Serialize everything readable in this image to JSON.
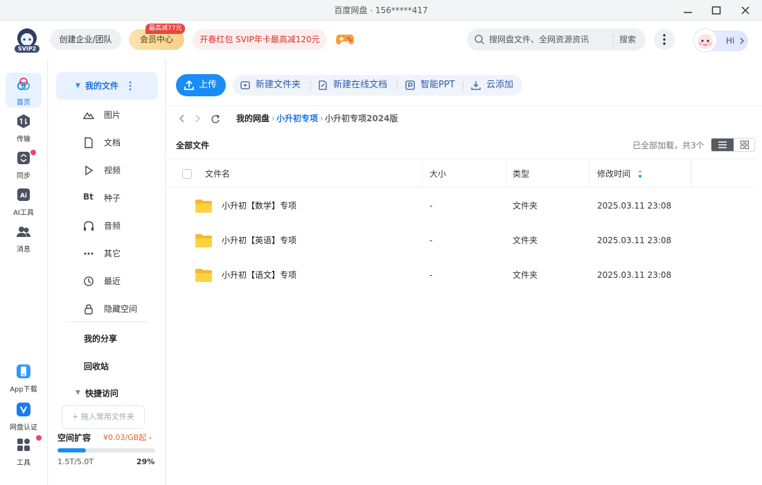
{
  "window": {
    "title": "百度网盘 · 156*****417"
  },
  "header": {
    "logo_text": "SVIP2",
    "enterprise": "创建企业/团队",
    "vip_center": "会员中心",
    "vip_badge": "最高减77元",
    "promo": "开春红包 SVIP年卡最高减120元",
    "search_placeholder": "搜网盘文件、全网资源资讯",
    "search_button": "搜索",
    "greeting": "Hi"
  },
  "rail": {
    "items": [
      {
        "label": "首页",
        "icon": "home-icon",
        "active": true
      },
      {
        "label": "传输",
        "icon": "transfer-icon"
      },
      {
        "label": "同步",
        "icon": "sync-icon"
      },
      {
        "label": "AI工具",
        "icon": "ai-tools-icon"
      },
      {
        "label": "消息",
        "icon": "messages-icon"
      }
    ],
    "bottom": [
      {
        "label": "App下载",
        "icon": "phone-icon"
      },
      {
        "label": "网盘认证",
        "icon": "shield-check-icon"
      },
      {
        "label": "工具",
        "icon": "grid-tools-icon"
      }
    ]
  },
  "nav": {
    "my_files": "我的文件",
    "categories": [
      {
        "label": "图片",
        "icon": "image-icon"
      },
      {
        "label": "文档",
        "icon": "document-icon"
      },
      {
        "label": "视频",
        "icon": "video-icon"
      },
      {
        "label": "种子",
        "icon": "bt-icon",
        "glyph": "Bt"
      },
      {
        "label": "音频",
        "icon": "headphones-icon"
      },
      {
        "label": "其它",
        "icon": "more-dots-icon"
      },
      {
        "label": "最近",
        "icon": "history-icon"
      },
      {
        "label": "隐藏空间",
        "icon": "lock-icon"
      }
    ],
    "my_share": "我的分享",
    "recycle": "回收站",
    "quick_access": "快捷访问",
    "drop_hint": "+ 拖入常用文件夹",
    "space_label": "空间扩容",
    "space_price": "¥0.03/GB起",
    "space_used": "1.5T/5.0T",
    "space_percent": "29%",
    "space_fraction": 0.29
  },
  "toolbar": {
    "upload": "上传",
    "new_folder": "新建文件夹",
    "new_doc": "新建在线文档",
    "smart_ppt": "智能PPT",
    "cloud_add": "云添加"
  },
  "breadcrumb": {
    "root": "我的网盘",
    "mid": "小升初专项",
    "current": "小升初专项2024版"
  },
  "list": {
    "heading": "全部文件",
    "status": "已全部加载，共3个",
    "columns": {
      "name": "文件名",
      "size": "大小",
      "type": "类型",
      "modified": "修改时间"
    },
    "rows": [
      {
        "name": "小升初【数学】专项",
        "size": "-",
        "type": "文件夹",
        "modified": "2025.03.11 23:08"
      },
      {
        "name": "小升初【英语】专项",
        "size": "-",
        "type": "文件夹",
        "modified": "2025.03.11 23:08"
      },
      {
        "name": "小升初【语文】专项",
        "size": "-",
        "type": "文件夹",
        "modified": "2025.03.11 23:08"
      }
    ]
  },
  "colors": {
    "accent": "#1a8cf5",
    "folder": "#f9c23c",
    "badge": "#e9453f"
  }
}
